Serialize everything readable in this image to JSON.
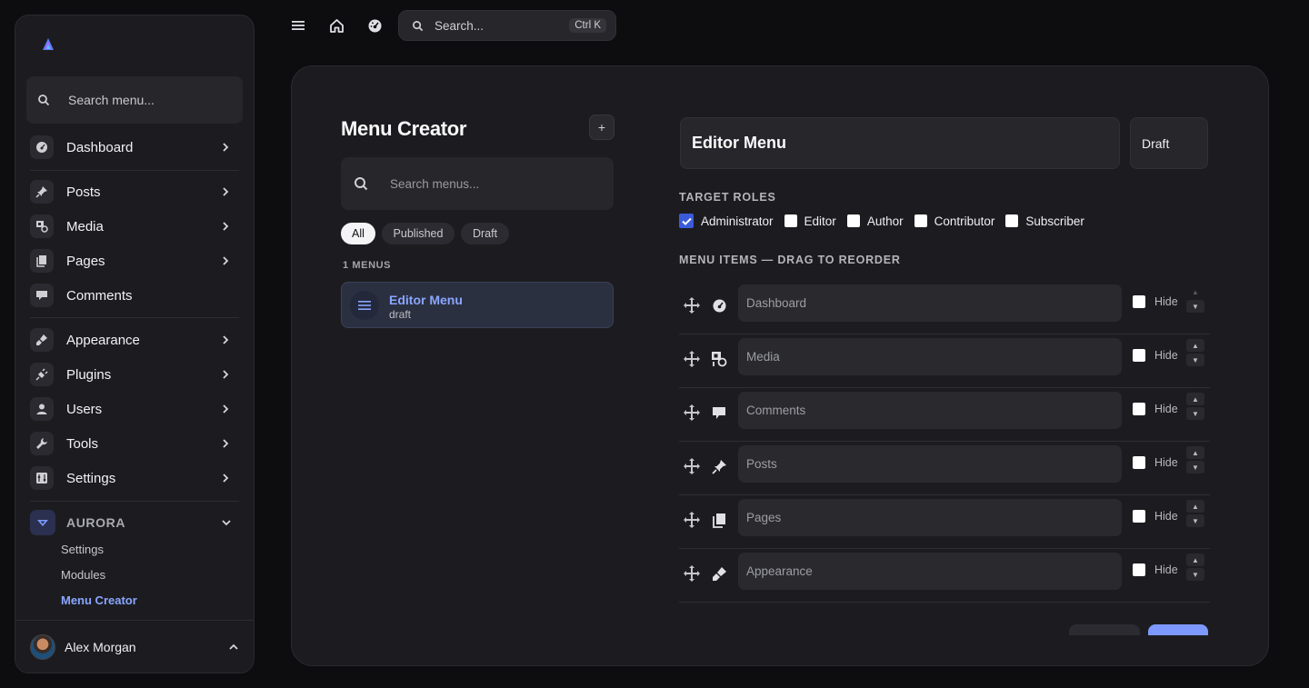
{
  "sidebar": {
    "search_placeholder": "Search menu...",
    "items": [
      {
        "label": "Dashboard",
        "icon": "dashboard-icon"
      },
      {
        "label": "Posts",
        "icon": "pin-icon"
      },
      {
        "label": "Media",
        "icon": "media-icon"
      },
      {
        "label": "Pages",
        "icon": "pages-icon"
      },
      {
        "label": "Comments",
        "icon": "comment-icon"
      },
      {
        "label": "Appearance",
        "icon": "brush-icon"
      },
      {
        "label": "Plugins",
        "icon": "plugin-icon"
      },
      {
        "label": "Users",
        "icon": "user-icon"
      },
      {
        "label": "Tools",
        "icon": "wrench-icon"
      },
      {
        "label": "Settings",
        "icon": "settings-icon"
      }
    ],
    "section": {
      "label": "AURORA",
      "subitems": [
        "Settings",
        "Modules",
        "Menu Creator"
      ],
      "active_subitem": "Menu Creator"
    },
    "user": {
      "name": "Alex Morgan"
    }
  },
  "topbar": {
    "search_placeholder": "Search...",
    "shortcut": "Ctrl K"
  },
  "menu_creator": {
    "title": "Menu Creator",
    "add_label": "+",
    "search_placeholder": "Search menus...",
    "filters": [
      "All",
      "Published",
      "Draft"
    ],
    "active_filter": "All",
    "count_label": "1 MENUS",
    "menus": [
      {
        "name": "Editor Menu",
        "status": "draft"
      }
    ]
  },
  "editor": {
    "menu_name": "Editor Menu",
    "status": "Draft",
    "roles_label": "TARGET ROLES",
    "roles": [
      {
        "label": "Administrator",
        "checked": true
      },
      {
        "label": "Editor",
        "checked": false
      },
      {
        "label": "Author",
        "checked": false
      },
      {
        "label": "Contributor",
        "checked": false
      },
      {
        "label": "Subscriber",
        "checked": false
      }
    ],
    "items_label": "MENU ITEMS — DRAG TO REORDER",
    "hide_label": "Hide",
    "items": [
      {
        "placeholder": "Dashboard",
        "icon": "dashboard-icon"
      },
      {
        "placeholder": "Media",
        "icon": "media-icon"
      },
      {
        "placeholder": "Comments",
        "icon": "comment-icon"
      },
      {
        "placeholder": "Posts",
        "icon": "pin-icon"
      },
      {
        "placeholder": "Pages",
        "icon": "pages-icon"
      },
      {
        "placeholder": "Appearance",
        "icon": "brush-icon"
      }
    ]
  },
  "colors": {
    "accent": "#8aa6ff",
    "checkbox_checked": "#3b5bdb",
    "background": "#0d0d0f",
    "surface": "#1c1c20"
  }
}
